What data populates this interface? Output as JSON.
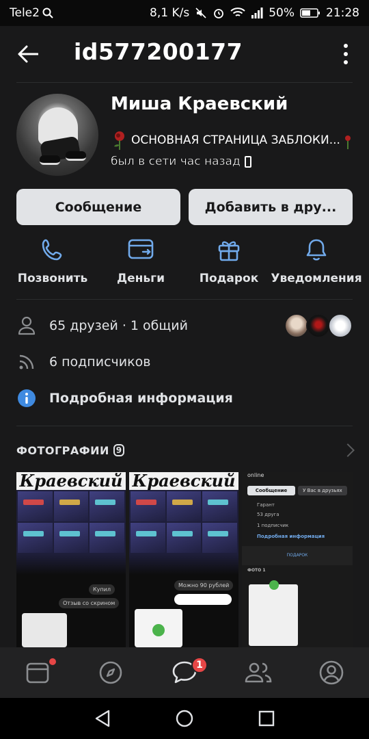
{
  "status_bar": {
    "carrier": "Tele2",
    "speed": "8,1 K/s",
    "battery": "50%",
    "time": "21:28"
  },
  "header": {
    "title": "id577200177"
  },
  "profile": {
    "name": "Миша Краевский",
    "status": "ОСНОВНАЯ СТРАНИЦА ЗАБЛОКИ...",
    "online": "был в сети час назад"
  },
  "buttons": {
    "message": "Сообщение",
    "add_friend": "Добавить в дру..."
  },
  "actions": [
    {
      "label": "Позвонить",
      "icon": "phone-icon"
    },
    {
      "label": "Деньги",
      "icon": "money-transfer-icon"
    },
    {
      "label": "Подарок",
      "icon": "gift-icon"
    },
    {
      "label": "Уведомления",
      "icon": "bell-icon"
    }
  ],
  "info": {
    "friends": "65 друзей · 1 общий",
    "followers": "6 подписчиков",
    "details": "Подробная информация"
  },
  "photos": {
    "title": "ФОТОГРАФИИ",
    "count": "9",
    "thumb_heading": "Краевский",
    "chat_bubbles": [
      "Купил",
      "Отзыв со скрином",
      "Можно 90 рублей"
    ],
    "mini_profile": {
      "online": "online",
      "message": "Сообщение",
      "friends_state": "У Вас в друзьях",
      "guarantor": "Гарант",
      "friends": "53 друга",
      "followers": "1 подписчик",
      "details": "Подробная информация",
      "gift": "ПОДАРОК",
      "photo": "ФОТО 1"
    }
  },
  "tabbar": {
    "messages_badge": "1"
  },
  "colors": {
    "background": "#19191a",
    "accent": "#71aaeb",
    "button": "#e1e3e6",
    "badge": "#e64646",
    "info_blue": "#3f8ae0"
  }
}
